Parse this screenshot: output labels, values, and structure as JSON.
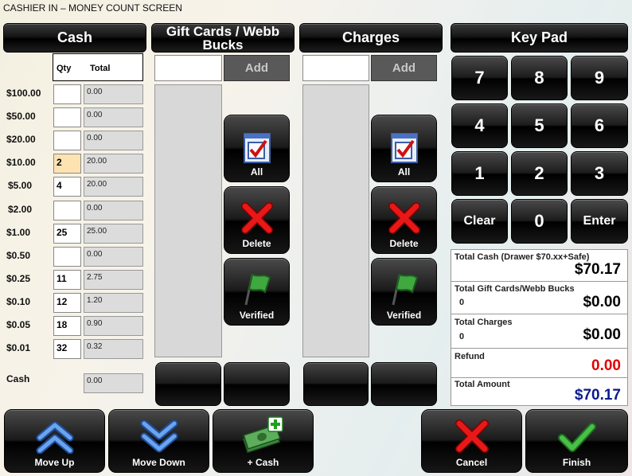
{
  "window": {
    "title": "CASHIER IN – MONEY COUNT SCREEN"
  },
  "headers": {
    "cash": "Cash",
    "gift": "Gift Cards / Webb Bucks",
    "charges": "Charges",
    "keypad": "Key Pad"
  },
  "cash_table": {
    "qty_header": "Qty",
    "total_header": "Total",
    "rows": [
      {
        "denom": "$100.00",
        "qty": "",
        "total": "0.00"
      },
      {
        "denom": "$50.00",
        "qty": "",
        "total": "0.00"
      },
      {
        "denom": "$20.00",
        "qty": "",
        "total": "0.00"
      },
      {
        "denom": "$10.00",
        "qty": "2",
        "total": "20.00"
      },
      {
        "denom": "$5.00",
        "qty": "4",
        "total": "20.00"
      },
      {
        "denom": "$2.00",
        "qty": "",
        "total": "0.00"
      },
      {
        "denom": "$1.00",
        "qty": "25",
        "total": "25.00"
      },
      {
        "denom": "$0.50",
        "qty": "",
        "total": "0.00"
      },
      {
        "denom": "$0.25",
        "qty": "11",
        "total": "2.75"
      },
      {
        "denom": "$0.10",
        "qty": "12",
        "total": "1.20"
      },
      {
        "denom": "$0.05",
        "qty": "18",
        "total": "0.90"
      },
      {
        "denom": "$0.01",
        "qty": "32",
        "total": "0.32"
      }
    ],
    "cash_label": "Cash",
    "cash_total": "0.00"
  },
  "gift": {
    "add_label": "Add",
    "all_label": "All",
    "delete_label": "Delete",
    "verified_label": "Verified"
  },
  "charges": {
    "add_label": "Add",
    "all_label": "All",
    "delete_label": "Delete",
    "verified_label": "Verified"
  },
  "keypad": {
    "keys": [
      "7",
      "8",
      "9",
      "4",
      "5",
      "6",
      "1",
      "2",
      "3",
      "Clear",
      "0",
      "Enter"
    ]
  },
  "totals": {
    "total_cash_label": "Total Cash (Drawer $70.xx+Safe)",
    "total_cash_value": "$70.17",
    "gift_label": "Total Gift Cards/Webb Bucks",
    "gift_count": "0",
    "gift_value": "$0.00",
    "charges_label": "Total Charges",
    "charges_count": "0",
    "charges_value": "$0.00",
    "refund_label": "Refund",
    "refund_value": "0.00",
    "amount_label": "Total Amount",
    "amount_value": "$70.17",
    "colors": {
      "refund": "#e00000",
      "amount": "#0a1a8c"
    }
  },
  "bottom": {
    "move_up": "Move Up",
    "move_down": "Move Down",
    "add_cash": "+ Cash",
    "cancel": "Cancel",
    "finish": "Finish"
  }
}
